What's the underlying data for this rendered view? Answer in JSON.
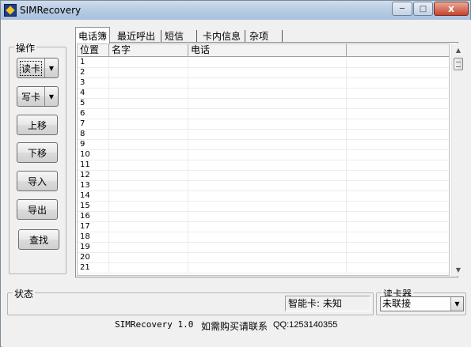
{
  "window": {
    "title": "SIMRecovery",
    "min_label": "─",
    "max_label": "□",
    "close_label": "x"
  },
  "operations": {
    "legend": "操作",
    "read_card": "读卡",
    "write_card": "写卡",
    "move_up": "上移",
    "move_down": "下移",
    "import": "导入",
    "export": "导出",
    "find": "查找",
    "dropdown_arrow": "▼"
  },
  "tabs": [
    {
      "label": "电话簿",
      "active": true
    },
    {
      "label": "最近呼出",
      "active": false
    },
    {
      "label": "短信",
      "active": false
    },
    {
      "label": "卡内信息",
      "active": false
    },
    {
      "label": "杂项",
      "active": false
    }
  ],
  "table": {
    "columns": [
      "位置",
      "名字",
      "电话",
      ""
    ],
    "rows": [
      "1",
      "2",
      "3",
      "4",
      "5",
      "6",
      "7",
      "8",
      "9",
      "10",
      "11",
      "12",
      "13",
      "14",
      "15",
      "16",
      "17",
      "18",
      "19",
      "20",
      "21"
    ]
  },
  "scrollbar": {
    "up": "▲",
    "down": "▼"
  },
  "status": {
    "legend": "状态",
    "smart_card": "智能卡: 未知"
  },
  "reader": {
    "legend": "读卡器",
    "selected": "未联接",
    "dropdown_arrow": "▼"
  },
  "footer": {
    "version": "SIMRecovery 1.0",
    "contact": "如需购买请联系",
    "qq": "QQ:1253140355"
  }
}
